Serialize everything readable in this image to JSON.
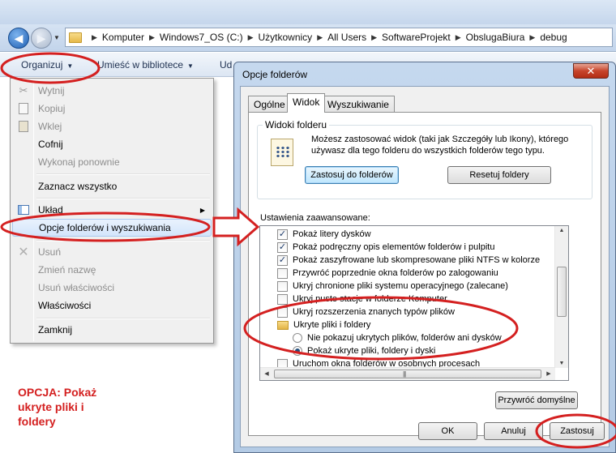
{
  "explorer": {
    "breadcrumb": [
      "Komputer",
      "Windows7_OS (C:)",
      "Użytkownicy",
      "All Users",
      "SoftwareProjekt",
      "ObslugaBiura",
      "debug"
    ],
    "toolbar": {
      "organize": "Organizuj",
      "library": "Umieść w bibliotece",
      "share_partial": "Ud"
    }
  },
  "menu": {
    "items": [
      {
        "label": "Wytnij",
        "enabled": false,
        "icon": "scissors-icon"
      },
      {
        "label": "Kopiuj",
        "enabled": false,
        "icon": "copy-icon"
      },
      {
        "label": "Wklej",
        "enabled": false,
        "icon": "paste-icon"
      },
      {
        "label": "Cofnij",
        "enabled": true
      },
      {
        "label": "Wykonaj ponownie",
        "enabled": false
      },
      {
        "label": "Zaznacz wszystko",
        "enabled": true
      },
      {
        "label": "Układ",
        "enabled": true,
        "icon": "layout-icon",
        "submenu": true
      },
      {
        "label": "Opcje folderów i wyszukiwania",
        "enabled": true,
        "highlighted": true
      },
      {
        "label": "Usuń",
        "enabled": false,
        "icon": "delete-icon"
      },
      {
        "label": "Zmień nazwę",
        "enabled": false
      },
      {
        "label": "Usuń właściwości",
        "enabled": false
      },
      {
        "label": "Właściwości",
        "enabled": true
      },
      {
        "label": "Zamknij",
        "enabled": true
      }
    ]
  },
  "dialog": {
    "title": "Opcje folderów",
    "close_glyph": "✕",
    "tabs": [
      "Ogólne",
      "Widok",
      "Wyszukiwanie"
    ],
    "active_tab": "Widok",
    "folder_views": {
      "title": "Widoki folderu",
      "text": "Możesz zastosować widok (taki jak Szczegóły lub Ikony), którego używasz dla tego folderu do wszystkich folderów tego typu.",
      "apply_button": "Zastosuj do folderów",
      "reset_button": "Resetuj foldery"
    },
    "advanced": {
      "label": "Ustawienia zaawansowane:",
      "rows": [
        {
          "type": "checkbox",
          "checked": true,
          "label": "Pokaż litery dysków"
        },
        {
          "type": "checkbox",
          "checked": true,
          "label": "Pokaż podręczny opis elementów folderów i pulpitu"
        },
        {
          "type": "checkbox",
          "checked": true,
          "label": "Pokaż zaszyfrowane lub skompresowane pliki NTFS w kolorze"
        },
        {
          "type": "checkbox",
          "checked": false,
          "label": "Przywróć poprzednie okna folderów po zalogowaniu"
        },
        {
          "type": "checkbox",
          "checked": false,
          "label": "Ukryj chronione pliki systemu operacyjnego (zalecane)"
        },
        {
          "type": "checkbox",
          "checked": false,
          "label": "Ukryj puste stacje w folderze Komputer"
        },
        {
          "type": "checkbox",
          "checked": false,
          "label": "Ukryj rozszerzenia znanych typów plików"
        },
        {
          "type": "folder",
          "label": "Ukryte pliki i foldery"
        },
        {
          "type": "radio",
          "checked": false,
          "label": "Nie pokazuj ukrytych plików, folderów ani dysków"
        },
        {
          "type": "radio",
          "checked": true,
          "label": "Pokaż ukryte pliki, foldery i dyski"
        },
        {
          "type": "checkbox",
          "checked": false,
          "label": "Uruchom okna folderów w osobnych procesach"
        }
      ]
    },
    "restore_defaults": "Przywróć domyślne",
    "ok": "OK",
    "cancel": "Anuluj",
    "apply": "Zastosuj"
  },
  "annotation": {
    "text": "OPCJA: Pokaż\nukryte pliki i\nfoldery",
    "color": "#d42020"
  }
}
